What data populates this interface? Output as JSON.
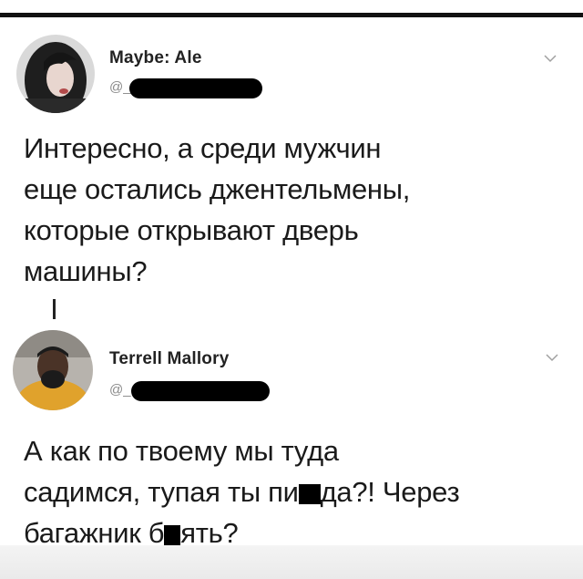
{
  "tweets": [
    {
      "name": "Maybe: Ale",
      "handle_prefix": "@_",
      "text_lines": [
        "Интересно, а среди мужчин",
        "еще остались джентельмены,",
        "которые открывают дверь",
        "машины?"
      ]
    },
    {
      "name": "Terrell Mallory",
      "handle_prefix": "@_",
      "text_line1": "А как по твоему мы туда",
      "text_line2_a": "садимся, тупая ты пи",
      "text_line2_b": "да?! Через",
      "text_line3_a": "багажник б",
      "text_line3_b": "ять?"
    }
  ],
  "icons": {
    "more": "chevron-down-icon",
    "redaction": "black-redaction-bar"
  },
  "colors": {
    "handle": "#8a8a8a",
    "text": "#1a1a1a"
  }
}
